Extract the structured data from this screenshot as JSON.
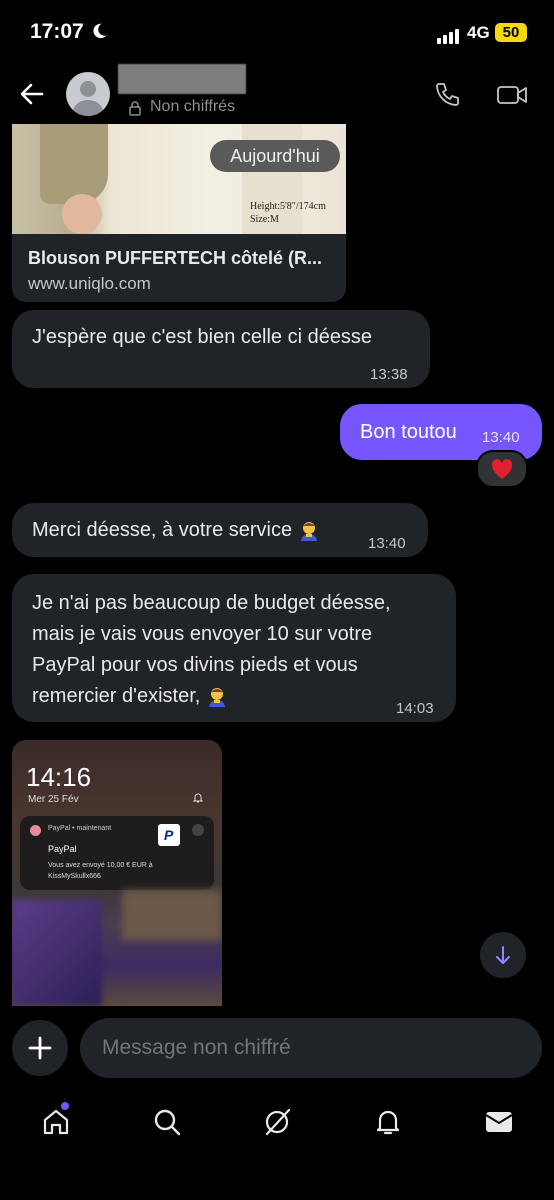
{
  "status": {
    "time": "17:07",
    "network": "4G",
    "battery": "50"
  },
  "header": {
    "encryption_label": "Non chiffrés"
  },
  "link_card": {
    "badge": "Aujourd'hui",
    "caption_line1": "Height:5'8\"/174cm",
    "caption_line2": "Size:M",
    "title": "Blouson PUFFERTECH côtelé (R...",
    "domain": "www.uniqlo.com"
  },
  "messages": [
    {
      "text": "J'espère que c'est bien celle ci déesse",
      "time": "13:38",
      "direction": "in"
    },
    {
      "text": "Bon toutou",
      "time": "13:40",
      "direction": "out",
      "reaction": "heart"
    },
    {
      "text": "Merci déesse, à votre service",
      "time": "13:40",
      "direction": "in",
      "emoji": "bowing-person"
    },
    {
      "lines": [
        "Je n'ai pas beaucoup de budget déesse,",
        "mais je vais vous envoyer 10 sur votre",
        "PayPal pour vos divins pieds et vous",
        "remercier d'exister,"
      ],
      "time": "14:03",
      "direction": "in",
      "emoji": "bowing-person"
    }
  ],
  "screenshot": {
    "time": "14:16",
    "date": "Mer 25 Fév",
    "notif_app": "PayPal • maintenant",
    "notif_title": "PayPal",
    "notif_body": "Vous avez envoyé 10,00 € EUR à KissMySkullx666",
    "logo_letter": "P"
  },
  "composer": {
    "placeholder": "Message non chiffré"
  },
  "nav": [
    "home-icon",
    "search-icon",
    "grok-icon",
    "notifications-icon",
    "messages-icon"
  ],
  "colors": {
    "accent": "#7856ff",
    "bubble": "#202327",
    "background": "#000000"
  }
}
